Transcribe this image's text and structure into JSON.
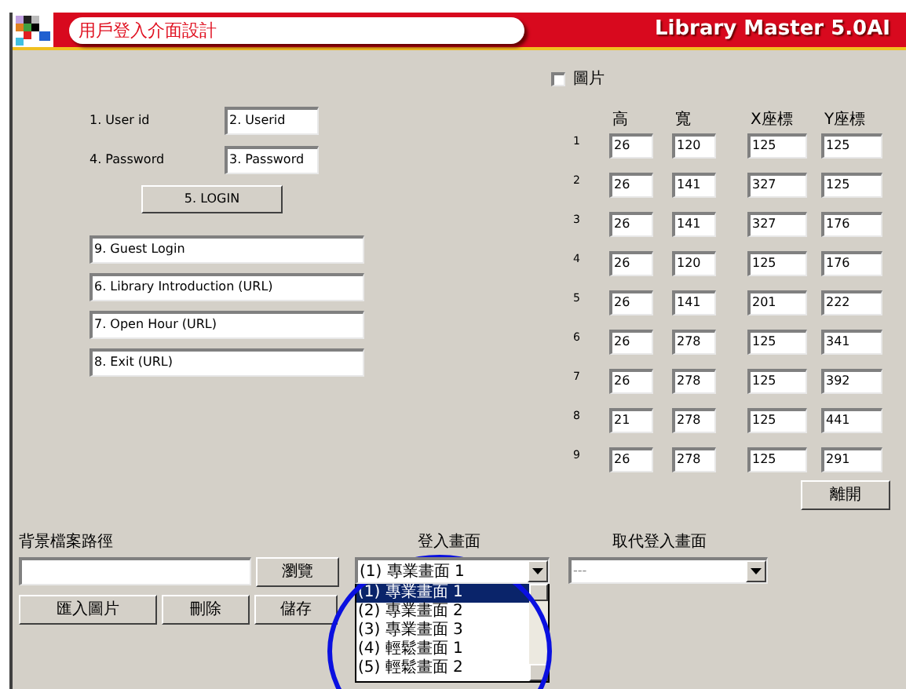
{
  "window": {
    "title": "用戶登入介面設計",
    "brand": "Library Master 5.0AI"
  },
  "login_form": {
    "fields": [
      {
        "label": "1. User id",
        "value": "2. Userid"
      },
      {
        "label": "4. Password",
        "value": "3. Password"
      }
    ],
    "login_button": "5. LOGIN",
    "link_fields": [
      "9. Guest Login",
      "6. Library Introduction (URL)",
      "7. Open Hour (URL)",
      "8. Exit (URL)"
    ]
  },
  "picture_option": {
    "label": "圖片",
    "checked": false
  },
  "position_table": {
    "columns": [
      "高",
      "寬",
      "X座標",
      "Y座標"
    ],
    "rows": [
      {
        "index": "1",
        "values": [
          "26",
          "120",
          "125",
          "125"
        ]
      },
      {
        "index": "2",
        "values": [
          "26",
          "141",
          "327",
          "125"
        ]
      },
      {
        "index": "3",
        "values": [
          "26",
          "141",
          "327",
          "176"
        ]
      },
      {
        "index": "4",
        "values": [
          "26",
          "120",
          "125",
          "176"
        ]
      },
      {
        "index": "5",
        "values": [
          "26",
          "141",
          "201",
          "222"
        ]
      },
      {
        "index": "6",
        "values": [
          "26",
          "278",
          "125",
          "341"
        ]
      },
      {
        "index": "7",
        "values": [
          "26",
          "278",
          "125",
          "392"
        ]
      },
      {
        "index": "8",
        "values": [
          "21",
          "278",
          "125",
          "441"
        ]
      },
      {
        "index": "9",
        "values": [
          "26",
          "278",
          "125",
          "291"
        ]
      }
    ]
  },
  "exit_button": "離開",
  "background": {
    "label": "背景檔案路徑",
    "browse_button": "瀏覽",
    "buttons": [
      "匯入圖片",
      "刪除",
      "儲存"
    ]
  },
  "login_screen": {
    "label": "登入畫面",
    "value": "(1) 專業畫面 1",
    "options": [
      {
        "label": "(1) 專業畫面 1",
        "selected": true
      },
      {
        "label": "(2) 專業畫面 2",
        "selected": false
      },
      {
        "label": "(3) 專業畫面 3",
        "selected": false
      },
      {
        "label": "(4) 輕鬆畫面 1",
        "selected": false
      },
      {
        "label": "(5) 輕鬆畫面 2",
        "selected": false
      }
    ]
  },
  "replace_screen": {
    "label": "取代登入畫面",
    "value": "---"
  }
}
